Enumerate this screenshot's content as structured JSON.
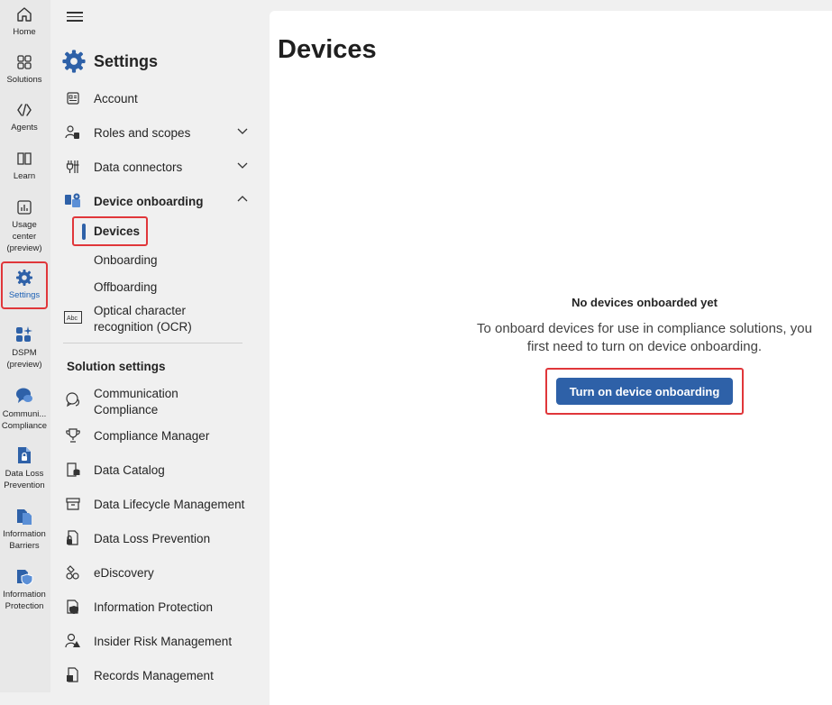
{
  "rail": {
    "items": [
      {
        "label": "Home",
        "icon": "home-icon"
      },
      {
        "label": "Solutions",
        "icon": "solutions-icon"
      },
      {
        "label": "Agents",
        "icon": "agents-icon"
      },
      {
        "label": "Learn",
        "icon": "learn-icon"
      },
      {
        "label": "Usage center (preview)",
        "icon": "usage-center-icon"
      },
      {
        "label": "Settings",
        "icon": "settings-icon",
        "active": true
      },
      {
        "label": "DSPM (preview)",
        "icon": "dspm-icon"
      },
      {
        "label": "Communi... Compliance",
        "icon": "communication-compliance-icon"
      },
      {
        "label": "Data Loss Prevention",
        "icon": "data-loss-prevention-icon"
      },
      {
        "label": "Information Barriers",
        "icon": "information-barriers-icon"
      },
      {
        "label": "Information Protection",
        "icon": "information-protection-icon"
      }
    ]
  },
  "nav": {
    "title": "Settings",
    "items": [
      {
        "label": "Account",
        "icon": "account-icon"
      },
      {
        "label": "Roles and scopes",
        "icon": "roles-icon",
        "expandable": true
      },
      {
        "label": "Data connectors",
        "icon": "data-connectors-icon",
        "expandable": true
      },
      {
        "label": "Device onboarding",
        "icon": "device-onboarding-icon",
        "expanded": true
      }
    ],
    "sub_items": [
      "Devices",
      "Onboarding",
      "Offboarding"
    ],
    "ocr": "Optical character recognition (OCR)",
    "section_heading": "Solution settings",
    "solutions": [
      {
        "label": "Communication Compliance",
        "icon": "communication-compliance-icon"
      },
      {
        "label": "Compliance Manager",
        "icon": "trophy-icon"
      },
      {
        "label": "Data Catalog",
        "icon": "data-catalog-icon"
      },
      {
        "label": "Data Lifecycle Management",
        "icon": "archive-icon"
      },
      {
        "label": "Data Loss Prevention",
        "icon": "lock-document-icon"
      },
      {
        "label": "eDiscovery",
        "icon": "ediscovery-icon"
      },
      {
        "label": "Information Protection",
        "icon": "shield-icon"
      },
      {
        "label": "Insider Risk Management",
        "icon": "insider-risk-icon"
      },
      {
        "label": "Records Management",
        "icon": "records-icon"
      }
    ]
  },
  "main": {
    "title": "Devices",
    "empty_title": "No devices onboarded yet",
    "empty_body": "To onboard devices for use in compliance solutions, you first need to turn on device onboarding.",
    "cta_label": "Turn on device onboarding"
  },
  "colors": {
    "accent": "#2e61a8",
    "highlight": "#e0363a"
  }
}
